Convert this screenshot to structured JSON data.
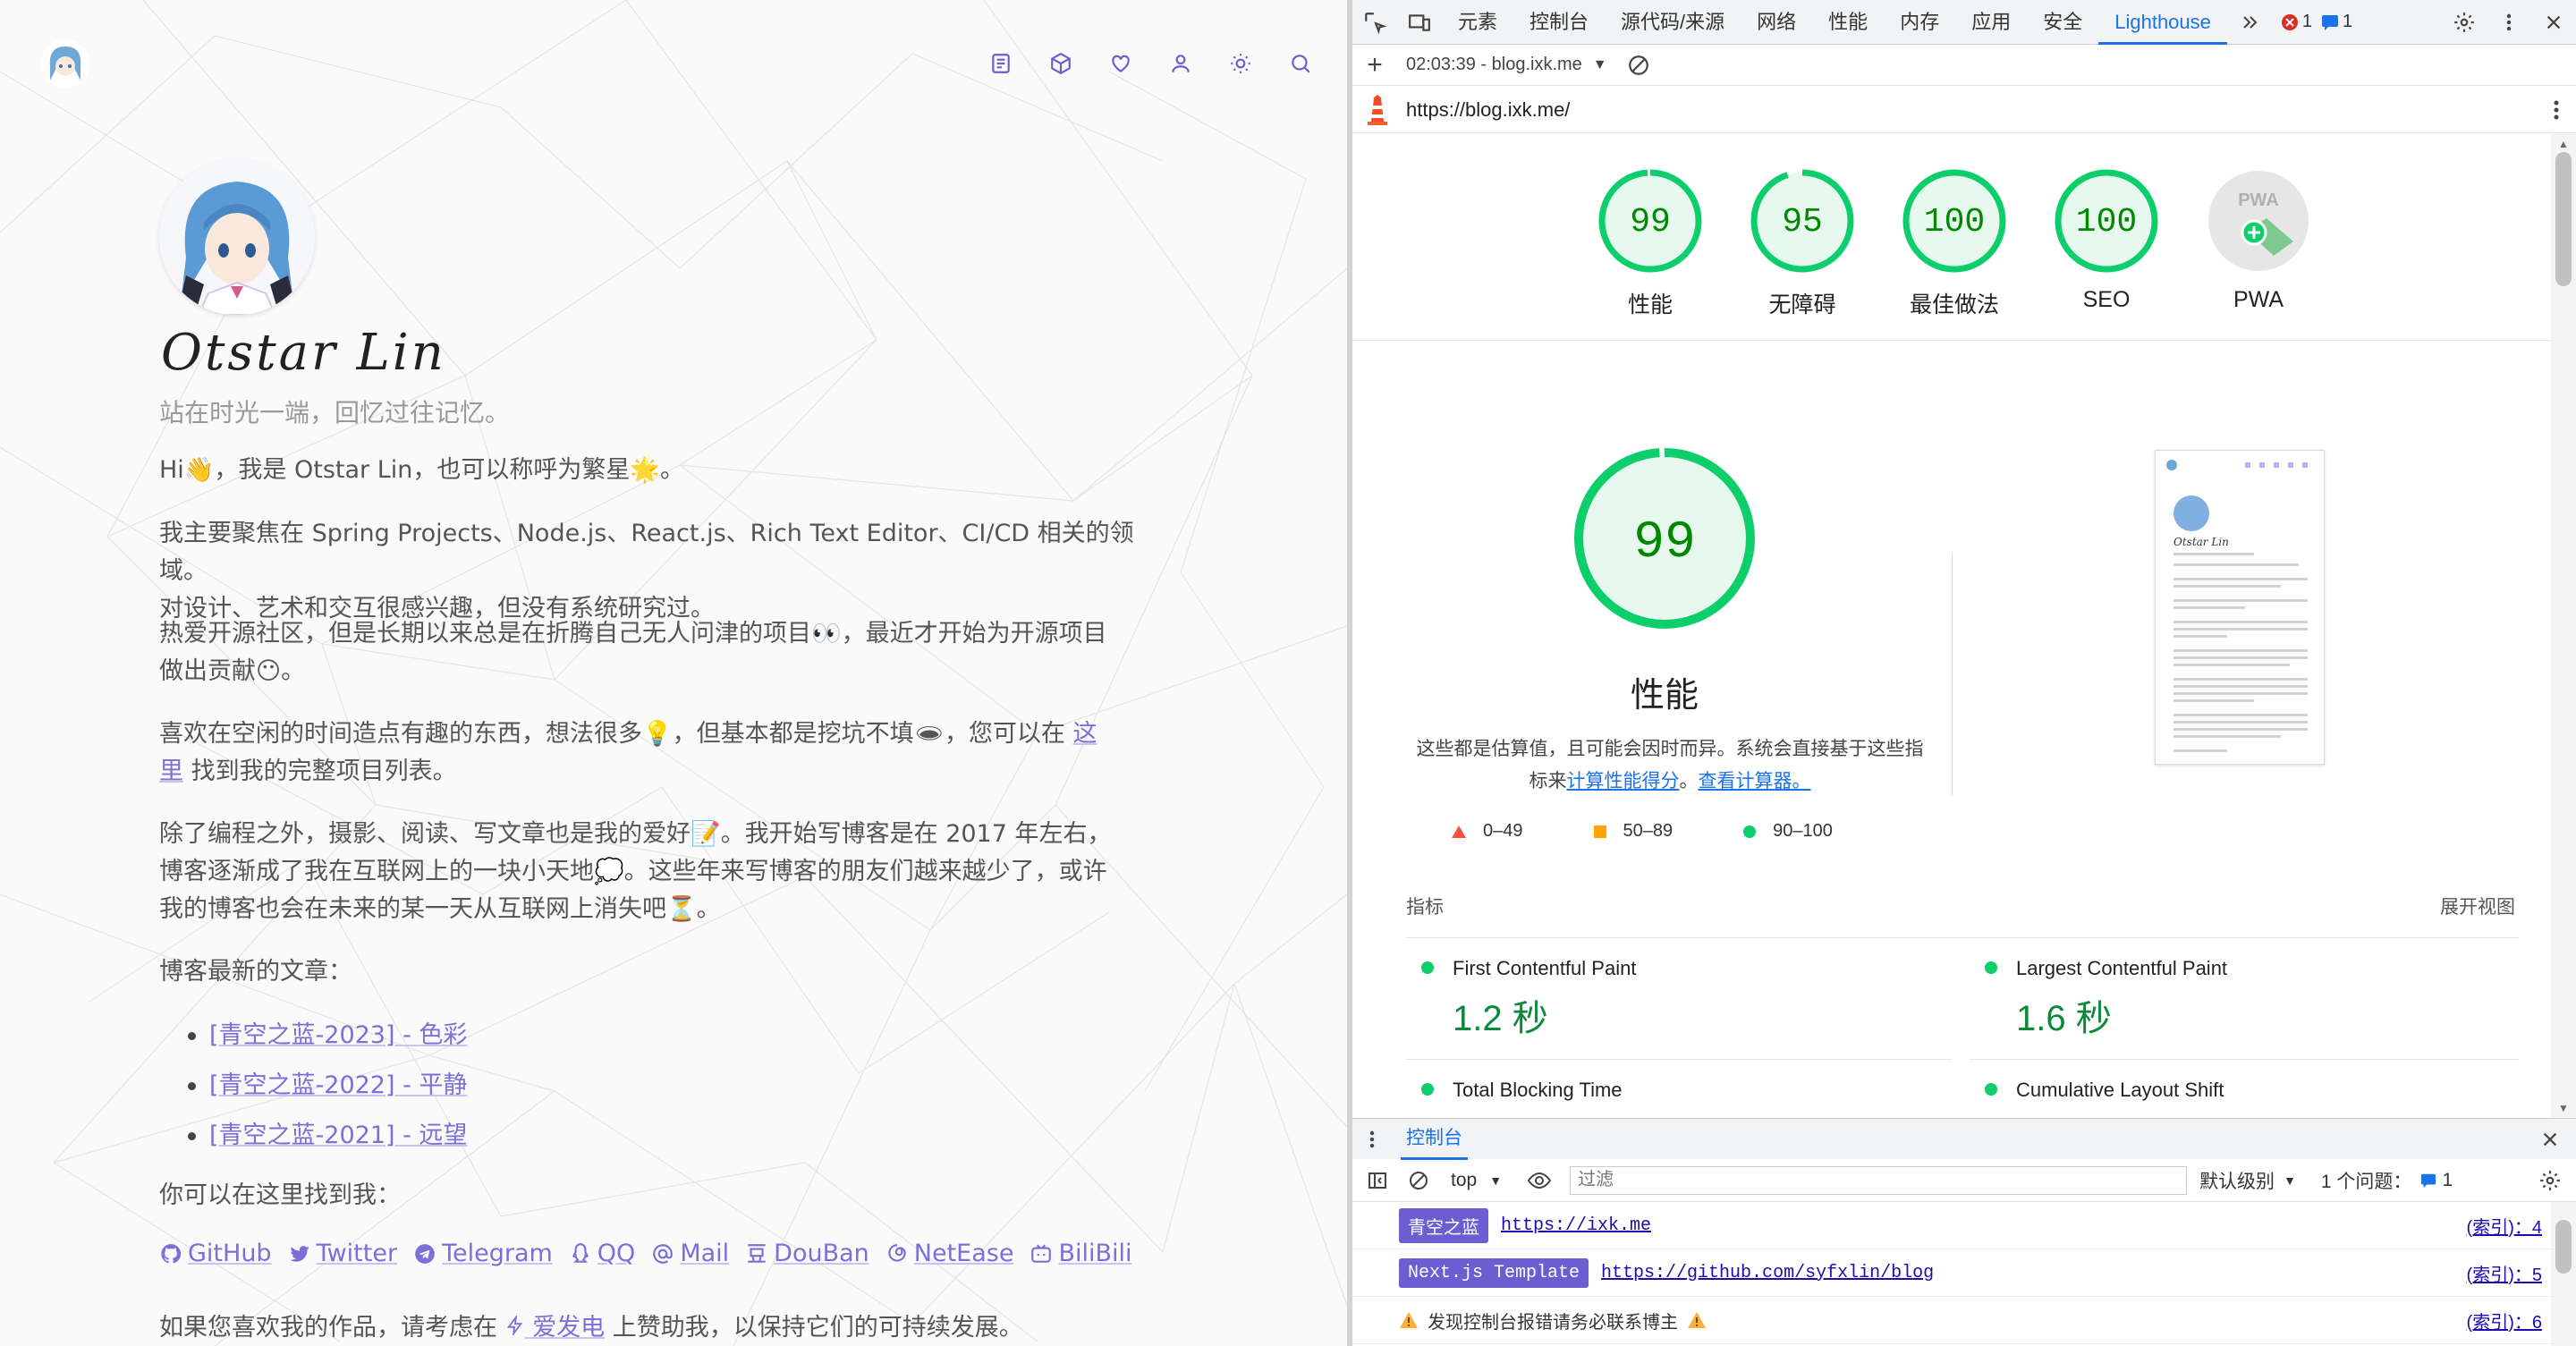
{
  "blog": {
    "name": "Otstar Lin",
    "tagline": "站在时光一端，回忆过往记忆。",
    "p1": "Hi👋，我是 Otstar Lin，也可以称呼为繁星🌟。",
    "p2a": "我主要聚焦在 Spring Projects、Node.js、React.js、Rich Text Editor、CI/CD 相关的领域。",
    "p2b": "对设计、艺术和交互很感兴趣，但没有系统研究过。",
    "p3a": "热爱开源社区，但是长期以来总是在折腾自己无人问津的项目👀，最近才开始为开源项目",
    "p3b": "做出贡献😶。",
    "p4a": "喜欢在空闲的时间造点有趣的东西，想法很多💡，但基本都是挖坑不填🕳，您可以在",
    "p4link1": "这",
    "p4link2": "里",
    "p4b": "找到我的完整项目列表。",
    "p5a": "除了编程之外，摄影、阅读、写文章也是我的爱好📝。我开始写博客是在 2017 年左右，",
    "p5b": "博客逐渐成了我在互联网上的一块小天地💭。这些年来写博客的朋友们越来越少了，或许",
    "p5c": "我的博客也会在未来的某一天从互联网上消失吧⏳。",
    "posts_label": "博客最新的文章：",
    "posts": [
      "[青空之蓝-2023] - 色彩",
      "[青空之蓝-2022] - 平静",
      "[青空之蓝-2021] - 远望"
    ],
    "find_me": "你可以在这里找到我：",
    "social": [
      "GitHub",
      "Twitter",
      "Telegram",
      "QQ",
      "Mail",
      "DouBan",
      "NetEase",
      "BiliBili"
    ],
    "donate_a": "如果您喜欢我的作品，请考虑在",
    "donate_link": "爱发电",
    "donate_b": "上赞助我，以保持它们的可持续发展。"
  },
  "devtools": {
    "tabs": [
      "元素",
      "控制台",
      "源代码/来源",
      "网络",
      "性能",
      "内存",
      "应用",
      "安全",
      "Lighthouse"
    ],
    "active_tab": "Lighthouse",
    "error_count": "1",
    "message_count": "1",
    "report_time": "02:03:39 - blog.ixk.me",
    "url": "https://blog.ixk.me/",
    "scores": [
      {
        "label": "性能",
        "value": 99
      },
      {
        "label": "无障碍",
        "value": 95
      },
      {
        "label": "最佳做法",
        "value": 100
      },
      {
        "label": "SEO",
        "value": 100
      }
    ],
    "pwa_label": "PWA",
    "pwa_badge": "PWA",
    "big_score": 99,
    "big_label": "性能",
    "note_a": "这些都是估算值，且可能会因时而异。系统会直接基于这些指",
    "note_b": "标来",
    "note_link1": "计算性能得分",
    "note_c": "。",
    "note_link2": "查看计算器。",
    "legend": [
      "0–49",
      "50–89",
      "90–100"
    ],
    "metrics_label": "指标",
    "expand_label": "展开视图",
    "metrics": [
      {
        "name": "First Contentful Paint",
        "value": "1.2 秒"
      },
      {
        "name": "Largest Contentful Paint",
        "value": "1.6 秒"
      },
      {
        "name": "Total Blocking Time",
        "value": ""
      },
      {
        "name": "Cumulative Layout Shift",
        "value": ""
      }
    ],
    "thumbnail_title": "Otstar Lin",
    "console_title": "控制台",
    "context": "top",
    "filter_placeholder": "过滤",
    "level": "默认级别",
    "issues": "1 个问题：",
    "issues_count": "1",
    "logs": [
      {
        "badge": "青空之蓝",
        "badge_color": "#6c5dd3",
        "link": "https://ixk.me",
        "src": "(索引)：4"
      },
      {
        "badge": "Next.js Template",
        "badge_color": "#6c5dd3",
        "link": "https://github.com/syfxlin/blog",
        "src": "(索引)：5"
      },
      {
        "badge": "",
        "text": "发现控制台报错请务必联系博主",
        "src": "(索引)：6"
      }
    ],
    "colors": {
      "good": "#0cce6b",
      "good_text": "#008800",
      "average": "#ffa400",
      "poor": "#ff4e42",
      "accent": "#1a73e8"
    }
  }
}
